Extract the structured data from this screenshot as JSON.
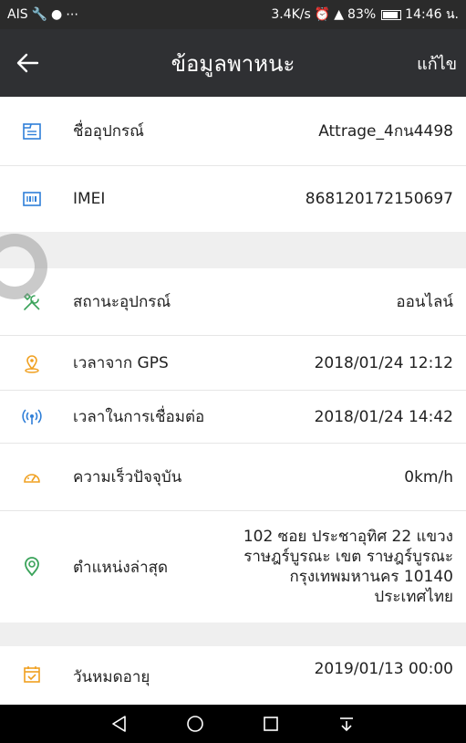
{
  "status_bar": {
    "left": "AIS",
    "right": "3.4K/s",
    "battery": "83%",
    "time": "14:46 น."
  },
  "header": {
    "title": "ข้อมูลพาหนะ",
    "edit_label": "แก้ไข"
  },
  "device": {
    "name_label": "ชื่ออุปกรณ์",
    "name_value": "Attrage_4กน4498",
    "imei_label": "IMEI",
    "imei_value": "868120172150697"
  },
  "status": {
    "state_label": "สถานะอุปกรณ์",
    "state_value": "ออนไลน์",
    "gps_label": "เวลาจาก GPS",
    "gps_value": "2018/01/24 12:12",
    "conn_label": "เวลาในการเชื่อมต่อ",
    "conn_value": "2018/01/24 14:42",
    "speed_label": "ความเร็วปัจจุบัน",
    "speed_value": "0km/h",
    "location_label": "ตำแหน่งล่าสุด",
    "location_lines": [
      "102 ซอย ประชาอุทิศ 22 แขวง",
      "ราษฎร์บูรณะ เขต ราษฎร์บูรณะ",
      "กรุงเทพมหานคร 10140",
      "ประเทศไทย"
    ]
  },
  "expiry": {
    "label": "วันหมดอายุ",
    "value": "2019/01/13 00:00"
  },
  "colors": {
    "accent": "#f0a020",
    "blue": "#2f7fd8",
    "green": "#3aa35a",
    "header": "#2f3033"
  }
}
